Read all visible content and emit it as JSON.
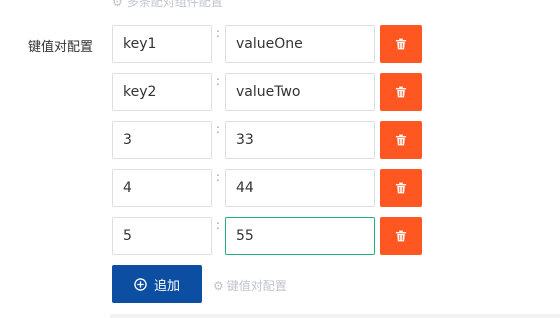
{
  "form": {
    "top_hint": "多条配对组件配置",
    "label": "键值对配置",
    "separator": ":",
    "rows": [
      {
        "key": "key1",
        "value": "valueOne"
      },
      {
        "key": "key2",
        "value": "valueTwo"
      },
      {
        "key": "3",
        "value": "33"
      },
      {
        "key": "4",
        "value": "44"
      },
      {
        "key": "5",
        "value": "55"
      }
    ],
    "add_label": "追加",
    "bottom_hint": "键值对配置"
  },
  "colors": {
    "delete_button": "#ff5722",
    "add_button": "#0b4ea2",
    "focus_border": "#26b07a"
  },
  "icons": {
    "delete": "trash-icon",
    "add": "plus-circle-icon",
    "hint": "gear-icon"
  },
  "state": {
    "focused_row": 4
  }
}
